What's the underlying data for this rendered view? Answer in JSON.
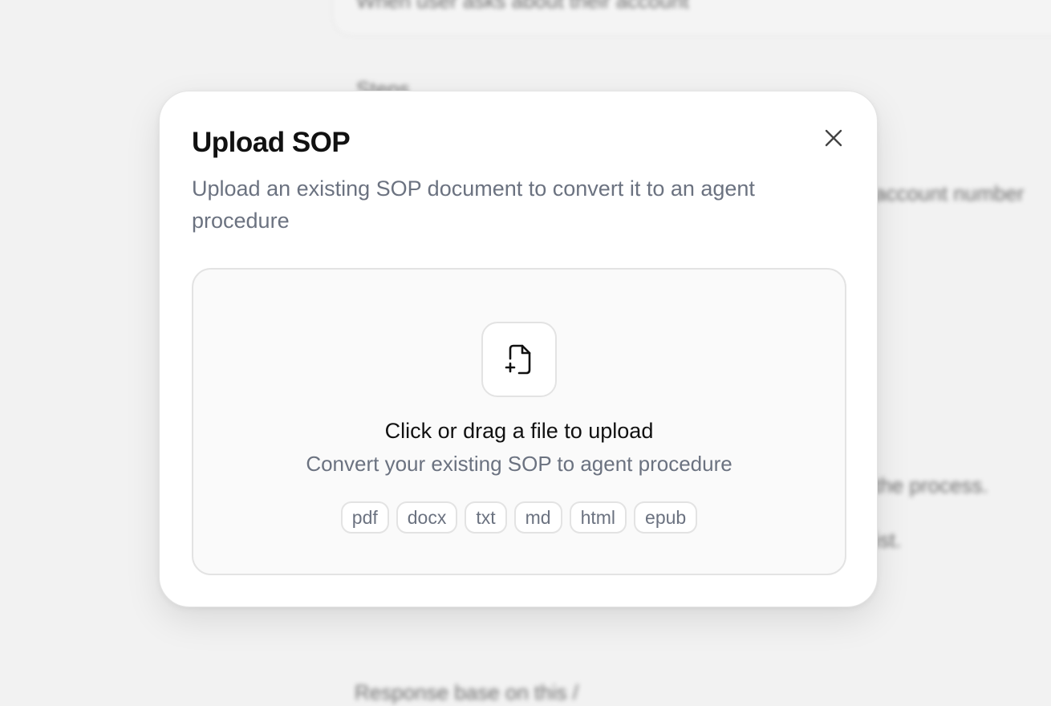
{
  "background": {
    "lines": [
      "When user asks about their account",
      "Steps",
      "account number",
      "the process.",
      "ist.",
      "Response base on this /"
    ]
  },
  "modal": {
    "title": "Upload SOP",
    "subtitle": "Upload an existing SOP document to convert it to an agent procedure",
    "close_icon": "close-icon",
    "dropzone": {
      "icon": "file-plus-icon",
      "title": "Click or drag a file to upload",
      "subtitle": "Convert your existing SOP to agent procedure",
      "formats": [
        "pdf",
        "docx",
        "txt",
        "md",
        "html",
        "epub"
      ]
    }
  },
  "colors": {
    "backdrop": "#f2f2f2",
    "modal_bg": "#ffffff",
    "title_text": "#111111",
    "muted_text": "#6b7280",
    "border": "#e3e3e3"
  }
}
